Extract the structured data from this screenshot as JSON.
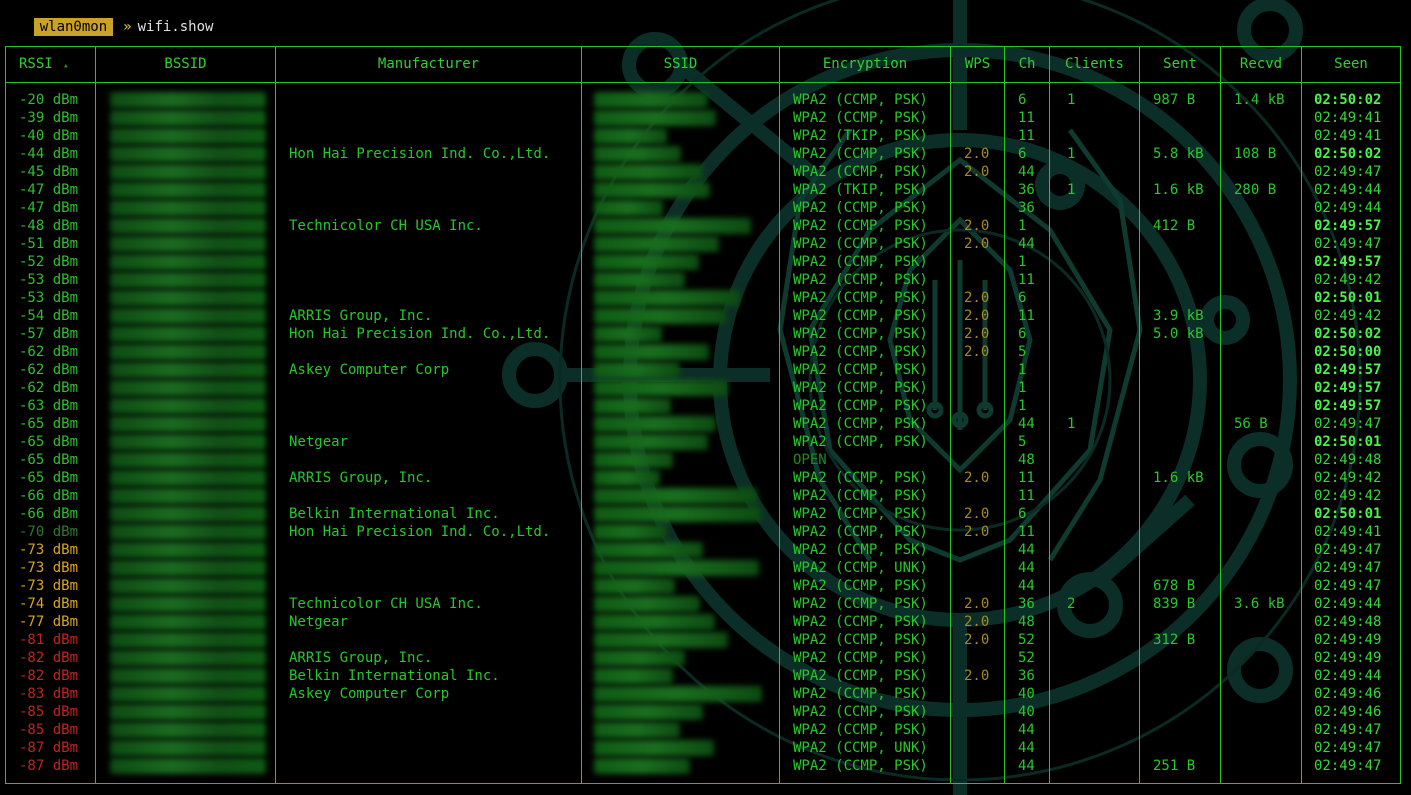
{
  "prompt": {
    "interface": "wlan0mon",
    "arrow": "»",
    "command": "wifi.show"
  },
  "colors": {
    "border": "#26c526",
    "text_green": "#28c828",
    "rssi_yellow": "#d9a520",
    "rssi_red": "#c0241c",
    "wps": "#a88a1e",
    "prompt_bg": "#c9a227",
    "logo": "#0c2e28"
  },
  "table": {
    "headers": {
      "rssi": "RSSI",
      "sort_indicator": "▴",
      "bssid": "BSSID",
      "manufacturer": "Manufacturer",
      "ssid": "SSID",
      "encryption": "Encryption",
      "wps": "WPS",
      "channel": "Ch",
      "clients": "Clients",
      "sent": "Sent",
      "recvd": "Recvd",
      "seen": "Seen"
    },
    "rows": [
      {
        "rssi": "-20 dBm",
        "level": "green",
        "manufacturer": "",
        "encryption": "WPA2 (CCMP, PSK)",
        "wps": "",
        "channel": "6",
        "clients": "1",
        "sent": "987 B",
        "recvd": "1.4 kB",
        "seen": "02:50:02",
        "recent": true
      },
      {
        "rssi": "-39 dBm",
        "level": "green",
        "manufacturer": "",
        "encryption": "WPA2 (CCMP, PSK)",
        "wps": "",
        "channel": "11",
        "clients": "",
        "sent": "",
        "recvd": "",
        "seen": "02:49:41",
        "recent": false
      },
      {
        "rssi": "-40 dBm",
        "level": "green",
        "manufacturer": "",
        "encryption": "WPA2 (TKIP, PSK)",
        "wps": "",
        "channel": "11",
        "clients": "",
        "sent": "",
        "recvd": "",
        "seen": "02:49:41",
        "recent": false
      },
      {
        "rssi": "-44 dBm",
        "level": "green",
        "manufacturer": "Hon Hai Precision Ind. Co.,Ltd.",
        "encryption": "WPA2 (CCMP, PSK)",
        "wps": "2.0",
        "channel": "6",
        "clients": "1",
        "sent": "5.8 kB",
        "recvd": "108 B",
        "seen": "02:50:02",
        "recent": true
      },
      {
        "rssi": "-45 dBm",
        "level": "green",
        "manufacturer": "",
        "encryption": "WPA2 (CCMP, PSK)",
        "wps": "2.0",
        "channel": "44",
        "clients": "",
        "sent": "",
        "recvd": "",
        "seen": "02:49:47",
        "recent": false
      },
      {
        "rssi": "-47 dBm",
        "level": "green",
        "manufacturer": "",
        "encryption": "WPA2 (TKIP, PSK)",
        "wps": "",
        "channel": "36",
        "clients": "1",
        "sent": "1.6 kB",
        "recvd": "280 B",
        "seen": "02:49:44",
        "recent": false
      },
      {
        "rssi": "-47 dBm",
        "level": "green",
        "manufacturer": "",
        "encryption": "WPA2 (CCMP, PSK)",
        "wps": "",
        "channel": "36",
        "clients": "",
        "sent": "",
        "recvd": "",
        "seen": "02:49:44",
        "recent": false
      },
      {
        "rssi": "-48 dBm",
        "level": "green",
        "manufacturer": "Technicolor CH USA Inc.",
        "encryption": "WPA2 (CCMP, PSK)",
        "wps": "2.0",
        "channel": "1",
        "clients": "",
        "sent": "412 B",
        "recvd": "",
        "seen": "02:49:57",
        "recent": true
      },
      {
        "rssi": "-51 dBm",
        "level": "green",
        "manufacturer": "",
        "encryption": "WPA2 (CCMP, PSK)",
        "wps": "2.0",
        "channel": "44",
        "clients": "",
        "sent": "",
        "recvd": "",
        "seen": "02:49:47",
        "recent": false
      },
      {
        "rssi": "-52 dBm",
        "level": "green",
        "manufacturer": "",
        "encryption": "WPA2 (CCMP, PSK)",
        "wps": "",
        "channel": "1",
        "clients": "",
        "sent": "",
        "recvd": "",
        "seen": "02:49:57",
        "recent": true
      },
      {
        "rssi": "-53 dBm",
        "level": "green",
        "manufacturer": "",
        "encryption": "WPA2 (CCMP, PSK)",
        "wps": "",
        "channel": "11",
        "clients": "",
        "sent": "",
        "recvd": "",
        "seen": "02:49:42",
        "recent": false
      },
      {
        "rssi": "-53 dBm",
        "level": "green",
        "manufacturer": "",
        "encryption": "WPA2 (CCMP, PSK)",
        "wps": "2.0",
        "channel": "6",
        "clients": "",
        "sent": "",
        "recvd": "",
        "seen": "02:50:01",
        "recent": true
      },
      {
        "rssi": "-54 dBm",
        "level": "green",
        "manufacturer": "ARRIS Group, Inc.",
        "encryption": "WPA2 (CCMP, PSK)",
        "wps": "2.0",
        "channel": "11",
        "clients": "",
        "sent": "3.9 kB",
        "recvd": "",
        "seen": "02:49:42",
        "recent": false
      },
      {
        "rssi": "-57 dBm",
        "level": "green",
        "manufacturer": "Hon Hai Precision Ind. Co.,Ltd.",
        "encryption": "WPA2 (CCMP, PSK)",
        "wps": "2.0",
        "channel": "6",
        "clients": "",
        "sent": "5.0 kB",
        "recvd": "",
        "seen": "02:50:02",
        "recent": true
      },
      {
        "rssi": "-62 dBm",
        "level": "green",
        "manufacturer": "",
        "encryption": "WPA2 (CCMP, PSK)",
        "wps": "2.0",
        "channel": "5",
        "clients": "",
        "sent": "",
        "recvd": "",
        "seen": "02:50:00",
        "recent": true
      },
      {
        "rssi": "-62 dBm",
        "level": "green",
        "manufacturer": "Askey Computer Corp",
        "encryption": "WPA2 (CCMP, PSK)",
        "wps": "",
        "channel": "1",
        "clients": "",
        "sent": "",
        "recvd": "",
        "seen": "02:49:57",
        "recent": true
      },
      {
        "rssi": "-62 dBm",
        "level": "green",
        "manufacturer": "",
        "encryption": "WPA2 (CCMP, PSK)",
        "wps": "",
        "channel": "1",
        "clients": "",
        "sent": "",
        "recvd": "",
        "seen": "02:49:57",
        "recent": true
      },
      {
        "rssi": "-63 dBm",
        "level": "green",
        "manufacturer": "",
        "encryption": "WPA2 (CCMP, PSK)",
        "wps": "",
        "channel": "1",
        "clients": "",
        "sent": "",
        "recvd": "",
        "seen": "02:49:57",
        "recent": true
      },
      {
        "rssi": "-65 dBm",
        "level": "green",
        "manufacturer": "",
        "encryption": "WPA2 (CCMP, PSK)",
        "wps": "",
        "channel": "44",
        "clients": "1",
        "sent": "",
        "recvd": "56 B",
        "seen": "02:49:47",
        "recent": false
      },
      {
        "rssi": "-65 dBm",
        "level": "green",
        "manufacturer": "Netgear",
        "encryption": "WPA2 (CCMP, PSK)",
        "wps": "",
        "channel": "5",
        "clients": "",
        "sent": "",
        "recvd": "",
        "seen": "02:50:01",
        "recent": true
      },
      {
        "rssi": "-65 dBm",
        "level": "green",
        "manufacturer": "",
        "encryption": "OPEN",
        "wps": "",
        "channel": "48",
        "clients": "",
        "sent": "",
        "recvd": "",
        "seen": "02:49:48",
        "recent": false
      },
      {
        "rssi": "-65 dBm",
        "level": "green",
        "manufacturer": "ARRIS Group, Inc.",
        "encryption": "WPA2 (CCMP, PSK)",
        "wps": "2.0",
        "channel": "11",
        "clients": "",
        "sent": "1.6 kB",
        "recvd": "",
        "seen": "02:49:42",
        "recent": false
      },
      {
        "rssi": "-66 dBm",
        "level": "green",
        "manufacturer": "",
        "encryption": "WPA2 (CCMP, PSK)",
        "wps": "",
        "channel": "11",
        "clients": "",
        "sent": "",
        "recvd": "",
        "seen": "02:49:42",
        "recent": false
      },
      {
        "rssi": "-66 dBm",
        "level": "green",
        "manufacturer": "Belkin International Inc.",
        "encryption": "WPA2 (CCMP, PSK)",
        "wps": "2.0",
        "channel": "6",
        "clients": "",
        "sent": "",
        "recvd": "",
        "seen": "02:50:01",
        "recent": true
      },
      {
        "rssi": "-70 dBm",
        "level": "dim",
        "manufacturer": "Hon Hai Precision Ind. Co.,Ltd.",
        "encryption": "WPA2 (CCMP, PSK)",
        "wps": "2.0",
        "channel": "11",
        "clients": "",
        "sent": "",
        "recvd": "",
        "seen": "02:49:41",
        "recent": false
      },
      {
        "rssi": "-73 dBm",
        "level": "yellow",
        "manufacturer": "",
        "encryption": "WPA2 (CCMP, PSK)",
        "wps": "",
        "channel": "44",
        "clients": "",
        "sent": "",
        "recvd": "",
        "seen": "02:49:47",
        "recent": false
      },
      {
        "rssi": "-73 dBm",
        "level": "yellow",
        "manufacturer": "",
        "encryption": "WPA2 (CCMP, UNK)",
        "wps": "",
        "channel": "44",
        "clients": "",
        "sent": "",
        "recvd": "",
        "seen": "02:49:47",
        "recent": false
      },
      {
        "rssi": "-73 dBm",
        "level": "yellow",
        "manufacturer": "",
        "encryption": "WPA2 (CCMP, PSK)",
        "wps": "",
        "channel": "44",
        "clients": "",
        "sent": "678 B",
        "recvd": "",
        "seen": "02:49:47",
        "recent": false
      },
      {
        "rssi": "-74 dBm",
        "level": "yellow",
        "manufacturer": "Technicolor CH USA Inc.",
        "encryption": "WPA2 (CCMP, PSK)",
        "wps": "2.0",
        "channel": "36",
        "clients": "2",
        "sent": "839 B",
        "recvd": "3.6 kB",
        "seen": "02:49:44",
        "recent": false
      },
      {
        "rssi": "-77 dBm",
        "level": "yellow",
        "manufacturer": "Netgear",
        "encryption": "WPA2 (CCMP, PSK)",
        "wps": "2.0",
        "channel": "48",
        "clients": "",
        "sent": "",
        "recvd": "",
        "seen": "02:49:48",
        "recent": false
      },
      {
        "rssi": "-81 dBm",
        "level": "red",
        "manufacturer": "",
        "encryption": "WPA2 (CCMP, PSK)",
        "wps": "2.0",
        "channel": "52",
        "clients": "",
        "sent": "312 B",
        "recvd": "",
        "seen": "02:49:49",
        "recent": false
      },
      {
        "rssi": "-82 dBm",
        "level": "red",
        "manufacturer": "ARRIS Group, Inc.",
        "encryption": "WPA2 (CCMP, PSK)",
        "wps": "",
        "channel": "52",
        "clients": "",
        "sent": "",
        "recvd": "",
        "seen": "02:49:49",
        "recent": false
      },
      {
        "rssi": "-82 dBm",
        "level": "red",
        "manufacturer": "Belkin International Inc.",
        "encryption": "WPA2 (CCMP, PSK)",
        "wps": "2.0",
        "channel": "36",
        "clients": "",
        "sent": "",
        "recvd": "",
        "seen": "02:49:44",
        "recent": false
      },
      {
        "rssi": "-83 dBm",
        "level": "red",
        "manufacturer": "Askey Computer Corp",
        "encryption": "WPA2 (CCMP, PSK)",
        "wps": "",
        "channel": "40",
        "clients": "",
        "sent": "",
        "recvd": "",
        "seen": "02:49:46",
        "recent": false
      },
      {
        "rssi": "-85 dBm",
        "level": "red",
        "manufacturer": "",
        "encryption": "WPA2 (CCMP, PSK)",
        "wps": "",
        "channel": "40",
        "clients": "",
        "sent": "",
        "recvd": "",
        "seen": "02:49:46",
        "recent": false
      },
      {
        "rssi": "-85 dBm",
        "level": "red",
        "manufacturer": "",
        "encryption": "WPA2 (CCMP, PSK)",
        "wps": "",
        "channel": "44",
        "clients": "",
        "sent": "",
        "recvd": "",
        "seen": "02:49:47",
        "recent": false
      },
      {
        "rssi": "-87 dBm",
        "level": "red",
        "manufacturer": "",
        "encryption": "WPA2 (CCMP, UNK)",
        "wps": "",
        "channel": "44",
        "clients": "",
        "sent": "",
        "recvd": "",
        "seen": "02:49:47",
        "recent": false
      },
      {
        "rssi": "-87 dBm",
        "level": "red",
        "manufacturer": "",
        "encryption": "WPA2 (CCMP, PSK)",
        "wps": "",
        "channel": "44",
        "clients": "",
        "sent": "251 B",
        "recvd": "",
        "seen": "02:49:47",
        "recent": false
      }
    ]
  }
}
